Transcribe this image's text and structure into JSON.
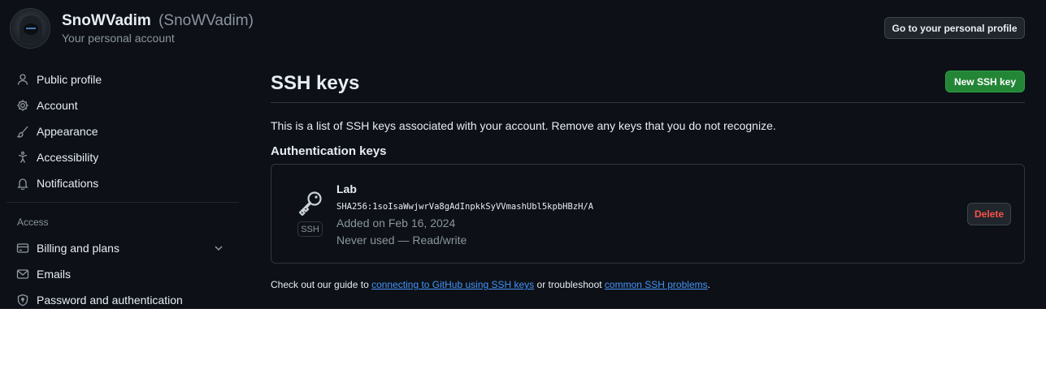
{
  "header": {
    "account_name": "SnoWVadim",
    "account_login": "(SnoWVadim)",
    "account_subtitle": "Your personal account",
    "profile_button": "Go to your personal profile"
  },
  "sidebar": {
    "items": [
      {
        "label": "Public profile",
        "icon": "person-icon"
      },
      {
        "label": "Account",
        "icon": "gear-icon"
      },
      {
        "label": "Appearance",
        "icon": "paintbrush-icon"
      },
      {
        "label": "Accessibility",
        "icon": "accessibility-icon"
      },
      {
        "label": "Notifications",
        "icon": "bell-icon"
      }
    ],
    "access_heading": "Access",
    "access_items": [
      {
        "label": "Billing and plans",
        "icon": "credit-card-icon"
      },
      {
        "label": "Emails",
        "icon": "mail-icon"
      },
      {
        "label": "Password and authentication",
        "icon": "shield-icon"
      }
    ]
  },
  "main": {
    "title": "SSH keys",
    "new_key_button": "New SSH key",
    "intro": "This is a list of SSH keys associated with your account. Remove any keys that you do not recognize.",
    "section_heading": "Authentication keys",
    "keys": [
      {
        "title": "Lab",
        "fingerprint": "SHA256:1soIsaWwjwrVa8gAdInpkkSyVVmashUbl5kpbHBzH/A",
        "added": "Added on Feb 16, 2024",
        "usage": "Never used — Read/write",
        "badge": "SSH",
        "delete_label": "Delete"
      }
    ],
    "footer": {
      "prefix": "Check out our guide to ",
      "link1": "connecting to GitHub using SSH keys",
      "middle": " or troubleshoot ",
      "link2": "common SSH problems",
      "suffix": "."
    }
  },
  "colors": {
    "background": "#0d1117",
    "border": "#30363d",
    "primary_button": "#238636",
    "danger": "#f85149",
    "link": "#4493f8",
    "muted_text": "#8b949e"
  }
}
